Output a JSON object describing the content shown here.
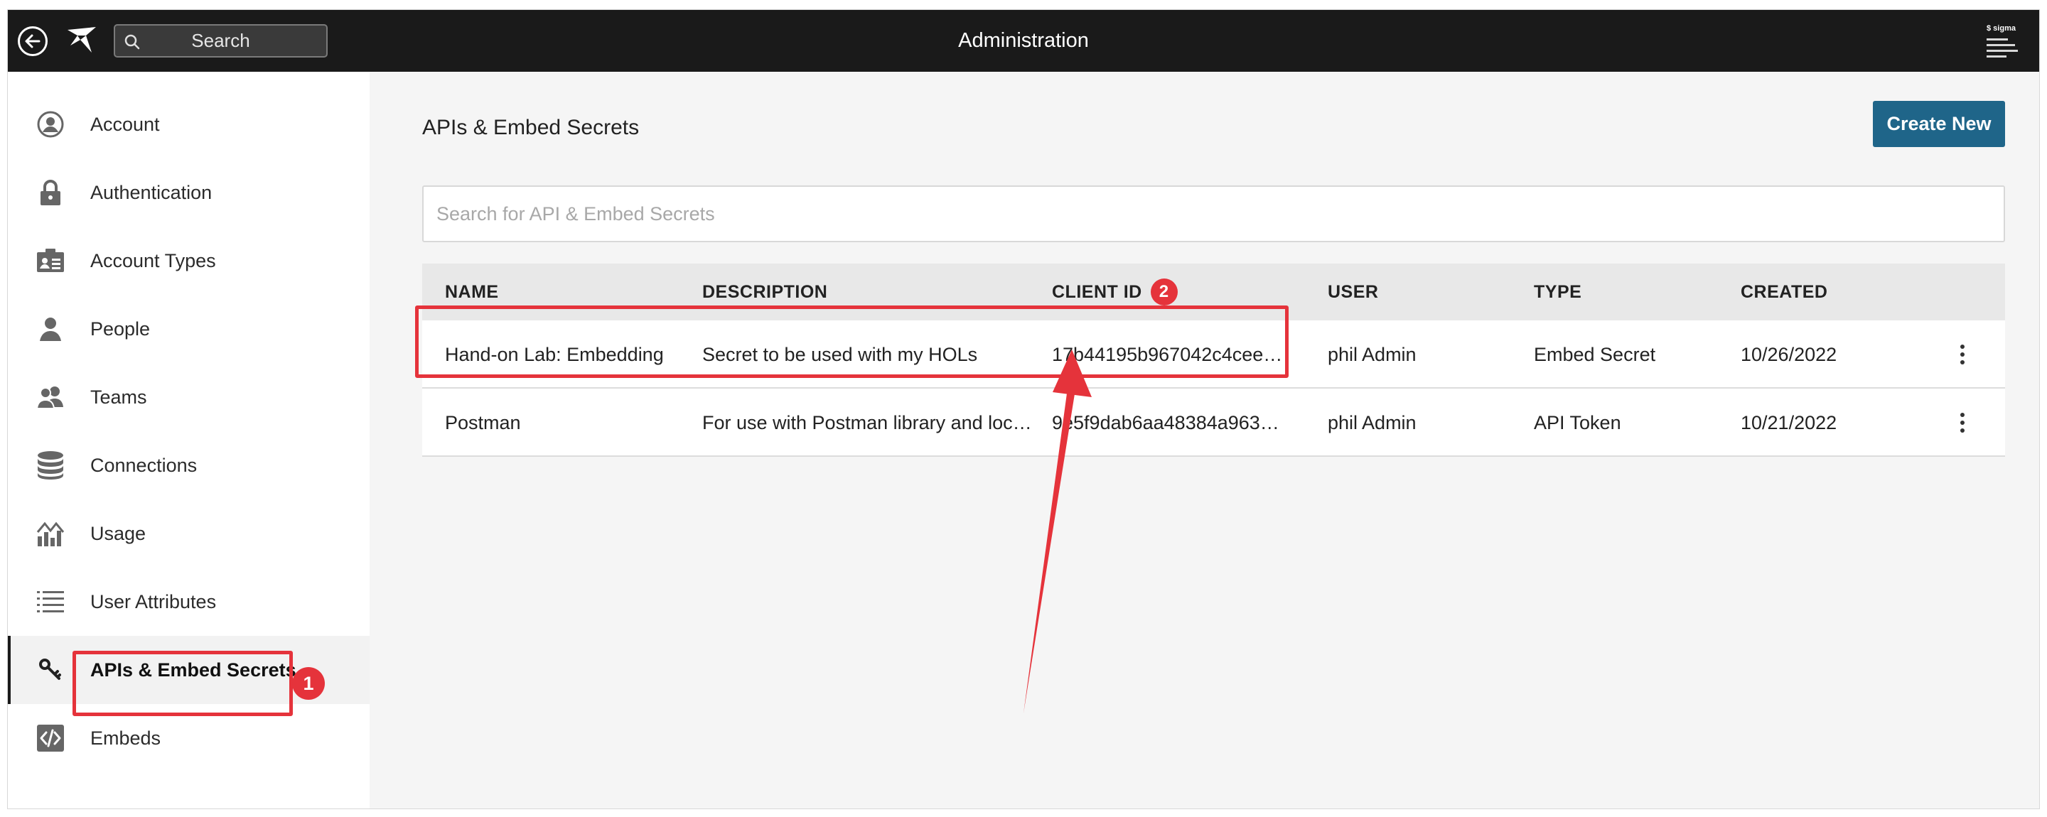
{
  "topbar": {
    "title": "Administration",
    "search_label": "Search"
  },
  "sidebar": {
    "items": [
      {
        "label": "Account",
        "icon": "account-icon"
      },
      {
        "label": "Authentication",
        "icon": "lock-icon"
      },
      {
        "label": "Account Types",
        "icon": "id-card-icon"
      },
      {
        "label": "People",
        "icon": "person-icon"
      },
      {
        "label": "Teams",
        "icon": "team-icon"
      },
      {
        "label": "Connections",
        "icon": "database-icon"
      },
      {
        "label": "Usage",
        "icon": "usage-chart-icon"
      },
      {
        "label": "User Attributes",
        "icon": "list-icon"
      },
      {
        "label": "APIs & Embed Secrets",
        "icon": "key-icon",
        "active": true
      },
      {
        "label": "Embeds",
        "icon": "code-icon"
      }
    ]
  },
  "main": {
    "title": "APIs & Embed Secrets",
    "create_label": "Create New",
    "search_placeholder": "Search for API & Embed Secrets",
    "columns": [
      "NAME",
      "DESCRIPTION",
      "CLIENT ID",
      "USER",
      "TYPE",
      "CREATED"
    ],
    "rows": [
      {
        "name": "Hand-on Lab: Embedding",
        "description": "Secret to be used with my HOLs",
        "client_id": "17b44195b967042c4cee…",
        "user": "phil Admin",
        "type": "Embed Secret",
        "created": "10/26/2022"
      },
      {
        "name": "Postman",
        "description": "For use with Postman library and loc…",
        "client_id": "9e5f9dab6aa48384a963…",
        "user": "phil Admin",
        "type": "API Token",
        "created": "10/21/2022"
      }
    ]
  },
  "annotations": {
    "badge_1": "1",
    "badge_2": "2",
    "color": "#e5333b"
  },
  "colors": {
    "topbar": "#1a1a1a",
    "accent_button": "#1f6589"
  }
}
